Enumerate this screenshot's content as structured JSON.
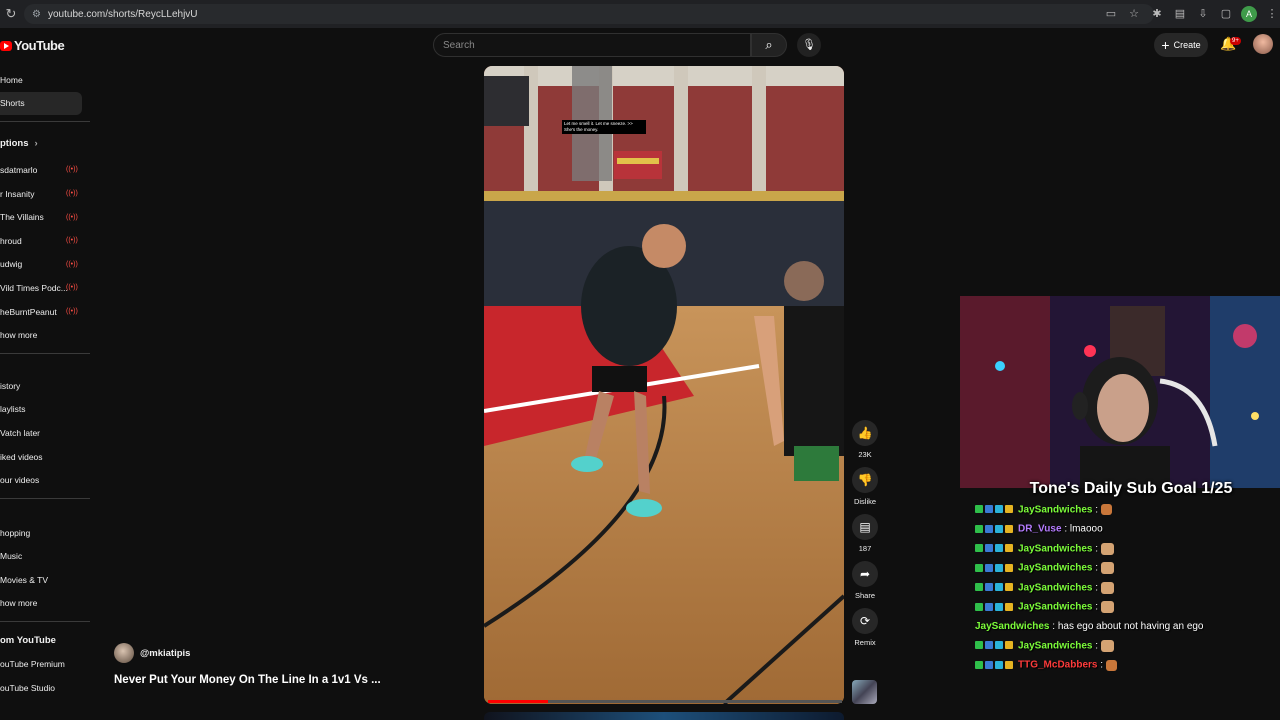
{
  "browser": {
    "url": "youtube.com/shorts/ReycLLehjvU",
    "profile_initial": "A"
  },
  "header": {
    "logo_text": "YouTube",
    "search_placeholder": "Search",
    "create_label": "Create",
    "notification_count": "9+"
  },
  "sidebar": {
    "top": [
      {
        "label": "Home"
      },
      {
        "label": "Shorts",
        "active": true
      }
    ],
    "subscriptions_title": "ptions",
    "subscriptions": [
      {
        "label": "sdatmarlo",
        "live": true
      },
      {
        "label": "r Insanity",
        "live": true
      },
      {
        "label": "The Villains",
        "live": true
      },
      {
        "label": "hroud",
        "live": true
      },
      {
        "label": "udwig",
        "live": true
      },
      {
        "label": "Vild Times Podc...",
        "live": true
      },
      {
        "label": "heBurntPeanut",
        "live": true
      }
    ],
    "show_more_1": "how more",
    "you": [
      {
        "label": "istory"
      },
      {
        "label": "laylists"
      },
      {
        "label": "Vatch later"
      },
      {
        "label": "iked videos"
      },
      {
        "label": "our videos"
      }
    ],
    "explore": [
      {
        "label": "hopping"
      },
      {
        "label": "Music"
      },
      {
        "label": "Movies & TV"
      }
    ],
    "show_more_2": "how more",
    "more_title": "om YouTube",
    "more": [
      {
        "label": "ouTube Premium"
      },
      {
        "label": "ouTube Studio"
      }
    ]
  },
  "video": {
    "caption": "Let me smell it. Let me sneeze. >> She's the money.",
    "progress": 0.17,
    "channel": "@mkiatipis",
    "title": "Never Put Your Money On The Line In a 1v1 Vs ..."
  },
  "actions": {
    "like_count": "23K",
    "dislike_label": "Dislike",
    "comment_count": "187",
    "share_label": "Share",
    "remix_label": "Remix"
  },
  "overlay": {
    "goal_text": "Tone's Daily Sub Goal 1/25",
    "chat": [
      {
        "user": "JaySandwiches",
        "color": "#7cfc3a",
        "msg": " : ",
        "emote": "small"
      },
      {
        "user": "DR_Vuse",
        "color": "#b57cff",
        "msg": " : lmaooo",
        "emote": ""
      },
      {
        "user": "JaySandwiches",
        "color": "#7cfc3a",
        "msg": " : ",
        "emote": "face"
      },
      {
        "user": "JaySandwiches",
        "color": "#7cfc3a",
        "msg": " : ",
        "emote": "face"
      },
      {
        "user": "JaySandwiches",
        "color": "#7cfc3a",
        "msg": " : ",
        "emote": "face"
      },
      {
        "user": "JaySandwiches",
        "color": "#7cfc3a",
        "msg": " : ",
        "emote": "face"
      },
      {
        "user": "JaySandwiches",
        "color": "#7cfc3a",
        "msg": " : has ego about not having an ego",
        "emote": "",
        "no_badges": true
      },
      {
        "user": "JaySandwiches",
        "color": "#7cfc3a",
        "msg": " : ",
        "emote": "face"
      },
      {
        "user": "TTG_McDabbers",
        "color": "#ff3b3b",
        "msg": " : ",
        "emote": "small"
      }
    ]
  }
}
